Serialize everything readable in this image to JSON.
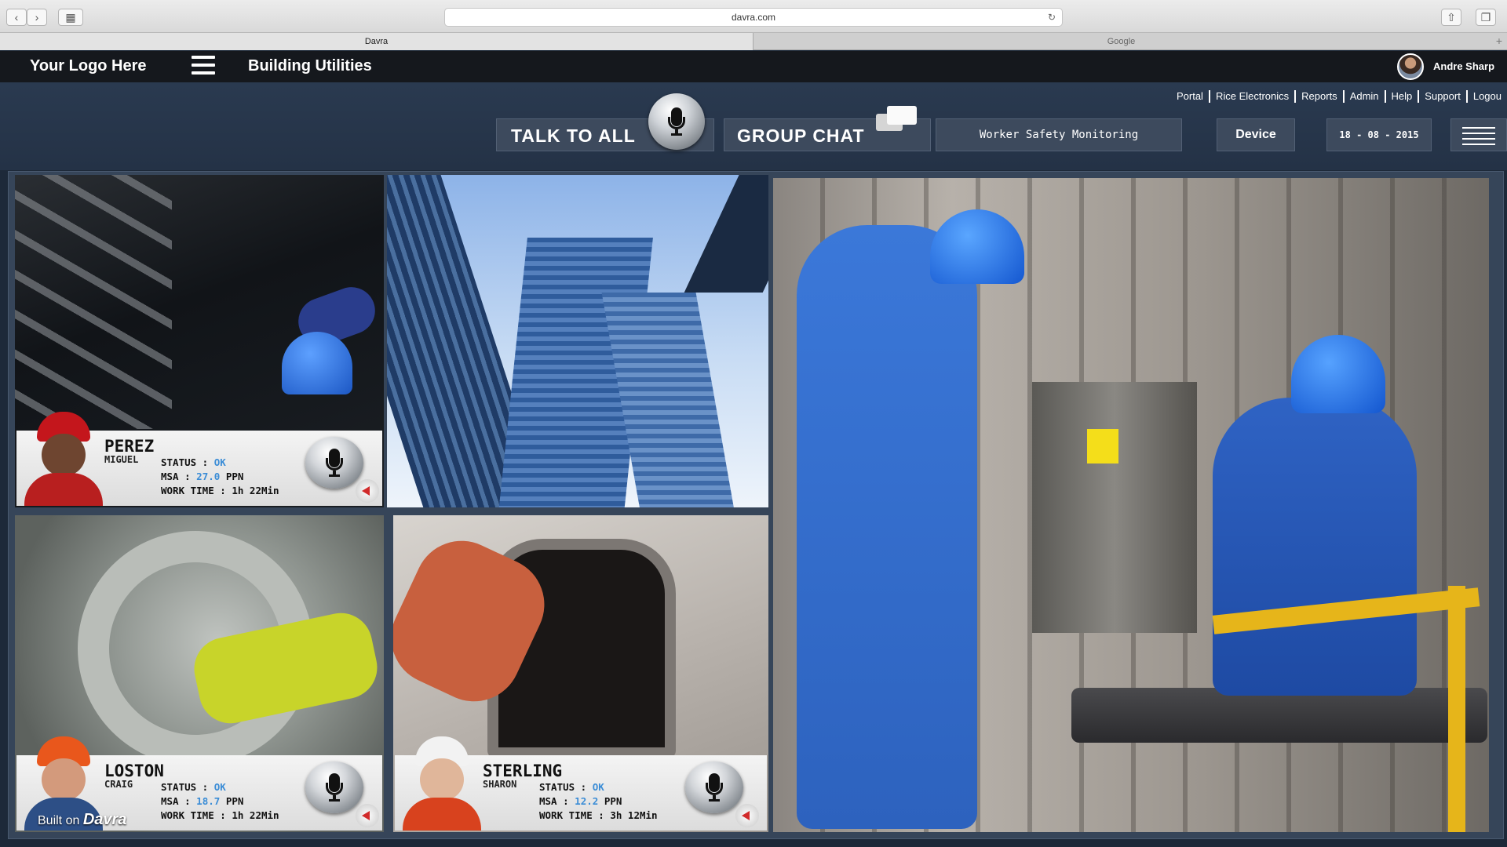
{
  "browser": {
    "url": "davra.com",
    "tabs": [
      {
        "label": "Davra"
      },
      {
        "label": "Google"
      }
    ]
  },
  "app": {
    "logo": "Your Logo Here",
    "title": "Building Utilities",
    "user": "Andre Sharp"
  },
  "nav_links": [
    "Portal",
    "Rice Electronics",
    "Reports",
    "Admin",
    "Help",
    "Support",
    "Logou"
  ],
  "toolbar": {
    "talk_to_all": "TALK TO ALL",
    "group_chat": "GROUP CHAT",
    "monitoring": "Worker Safety Monitoring",
    "device": "Device",
    "date": "18 - 08 - 2015"
  },
  "workers": [
    {
      "last": "PEREZ",
      "first": "MIGUEL",
      "status_label": "STATUS :",
      "status": "OK",
      "msa_label": "MSA :",
      "msa": "27.0",
      "msa_unit": "PPN",
      "work_label": "WORK TIME :",
      "work_h": "1h",
      "work_m": "22Min"
    },
    {
      "last": "LOSTON",
      "first": "CRAIG",
      "status_label": "STATUS :",
      "status": "OK",
      "msa_label": "MSA :",
      "msa": "18.7",
      "msa_unit": "PPN",
      "work_label": "WORK TIME :",
      "work_h": "1h",
      "work_m": "22Min"
    },
    {
      "last": "STERLING",
      "first": "SHARON",
      "status_label": "STATUS :",
      "status": "OK",
      "msa_label": "MSA :",
      "msa": "12.2",
      "msa_unit": "PPN",
      "work_label": "WORK TIME :",
      "work_h": "3h",
      "work_m": "12Min"
    }
  ],
  "footer": {
    "built_on": "Built on",
    "brand": "Davra"
  },
  "colors": {
    "header": "#15181d",
    "panel": "#3d4a5d",
    "accent_value": "#3a8cd6",
    "background": "#1d2939"
  }
}
